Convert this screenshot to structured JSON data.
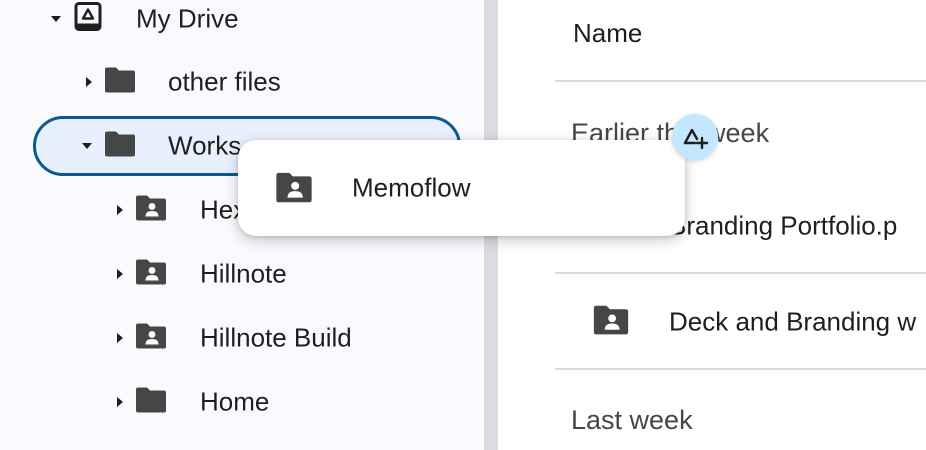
{
  "sidebar": {
    "items": [
      {
        "label": "My Drive",
        "icon": "drive-icon",
        "expanded": true
      },
      {
        "label": "other files",
        "icon": "folder-icon",
        "expanded": false
      },
      {
        "label": "Works",
        "icon": "folder-icon",
        "expanded": true,
        "selected": true
      },
      {
        "label": "Hex",
        "icon": "shared-folder-icon",
        "expanded": false
      },
      {
        "label": "Hillnote",
        "icon": "shared-folder-icon",
        "expanded": false
      },
      {
        "label": "Hillnote Build",
        "icon": "shared-folder-icon",
        "expanded": false
      },
      {
        "label": "Home",
        "icon": "folder-icon",
        "expanded": false
      }
    ]
  },
  "main": {
    "column_header": "Name",
    "sections": [
      {
        "title": "Earlier this week"
      },
      {
        "title": "Last week"
      }
    ],
    "files": [
      {
        "name": "Branding Portfolio.p",
        "icon": "pdf-icon"
      },
      {
        "name": "Deck and Branding w",
        "icon": "shared-folder-icon"
      }
    ]
  },
  "drag": {
    "label": "Memoflow",
    "icon": "shared-folder-icon",
    "drop_icon": "add-to-drive-icon"
  },
  "colors": {
    "selection_border": "#0a5a8f",
    "selection_fill": "#e8f0fe",
    "sidebar_bg": "#f8fafd",
    "drop_badge": "#c2e7ff",
    "pdf_red": "#d93025"
  }
}
